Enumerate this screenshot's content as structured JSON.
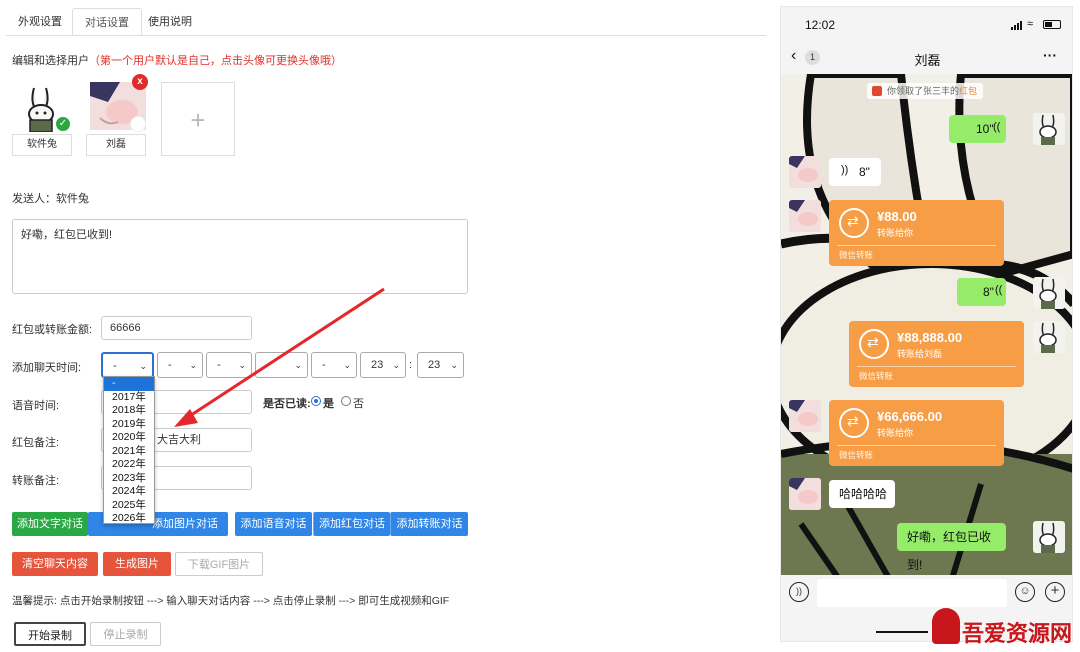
{
  "tabs": [
    "外观设置",
    "对话设置",
    "使用说明"
  ],
  "section_title": "编辑和选择用户",
  "section_hint": "（第一个用户默认是自己，点击头像可更换头像哦）",
  "users": [
    {
      "name": "软件兔",
      "selected": true
    },
    {
      "name": "刘磊",
      "removable": true
    }
  ],
  "add_user_symbol": "+",
  "sender_label": "发送人：软件兔",
  "message_text": "好嘞，红包已收到!",
  "amount_label": "红包或转账金额:",
  "amount_value": "66666",
  "time_label": "添加聊天时间:",
  "time_selects": [
    "-",
    "-",
    "-",
    "-",
    "-",
    "23",
    "23"
  ],
  "time_separator": ":",
  "dropdown_options": [
    "-",
    "2017年",
    "2018年",
    "2019年",
    "2020年",
    "2021年",
    "2022年",
    "2023年",
    "2024年",
    "2025年",
    "2026年"
  ],
  "voice_label": "语音时间:",
  "read_label": "是否已读:",
  "read_yes": "是",
  "read_no": "否",
  "redpack_label": "红包备注:",
  "redpack_value": "大吉大利",
  "transfer_label": "转账备注:",
  "buttons": {
    "add_text": "添加文字对话",
    "add_image": "添加图片对话",
    "add_voice": "添加语音对话",
    "add_redpack": "添加红包对话",
    "add_transfer": "添加转账对话",
    "clear": "清空聊天内容",
    "gen_image": "生成图片",
    "download_gif": "下载GIF图片",
    "start_record": "开始录制",
    "stop_record": "停止录制"
  },
  "tip": "温馨提示: 点击开始录制按钮 ---> 输入聊天对话内容 ---> 点击停止录制 ---> 即可生成视频和GIF",
  "colors": {
    "green": "#2aa843",
    "blue": "#2f86e6",
    "red": "#e6553b",
    "wechat_green": "#95ec69",
    "transfer_orange": "#f79d45"
  },
  "phone": {
    "time": "12:02",
    "title": "刘磊",
    "back_badge": "1",
    "more": "···",
    "system_msg_prefix": "你领取了张三丰的",
    "system_msg_link": "红包",
    "voice_right_1": "10\"",
    "voice_left": "8\"",
    "voice_right_2": "8\"",
    "transfer_left_1": {
      "amount": "¥88.00",
      "sub": "转账给你",
      "foot": "微信转账"
    },
    "transfer_right": {
      "amount": "¥88,888.00",
      "sub": "转账给刘磊",
      "foot": "微信转账"
    },
    "transfer_left_2": {
      "amount": "¥66,666.00",
      "sub": "转账给你",
      "foot": "微信转账"
    },
    "text_left": "哈哈哈哈",
    "text_right": "好嘞，红包已收到!"
  },
  "watermark": "吾爱资源网"
}
